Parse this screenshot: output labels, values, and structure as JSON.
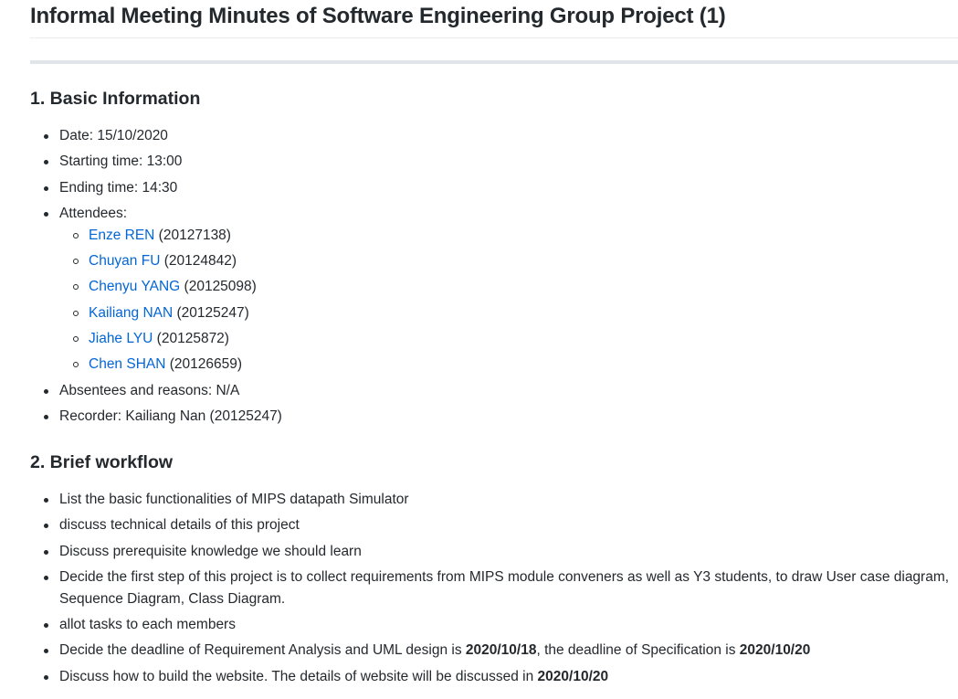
{
  "title": "Informal Meeting Minutes of Software Engineering Group Project (1)",
  "section1": {
    "heading": "1. Basic Information",
    "date": "Date: 15/10/2020",
    "start": "Starting time: 13:00",
    "end": "Ending time: 14:30",
    "attendees_label": "Attendees:",
    "attendees": [
      {
        "name": "Enze REN",
        "id": " (20127138)"
      },
      {
        "name": "Chuyan FU",
        "id": " (20124842)"
      },
      {
        "name": "Chenyu YANG",
        "id": " (20125098)"
      },
      {
        "name": "Kailiang NAN",
        "id": " (20125247)"
      },
      {
        "name": "Jiahe LYU",
        "id": " (20125872)"
      },
      {
        "name": "Chen SHAN",
        "id": " (20126659)"
      }
    ],
    "absentees": "Absentees and reasons: N/A",
    "recorder": "Recorder: Kailiang Nan (20125247)"
  },
  "section2": {
    "heading": "2. Brief workflow",
    "items": [
      "List the basic functionalities of MIPS datapath Simulator",
      "discuss technical details of this project",
      "Discuss prerequisite knowledge we should learn",
      "Decide the first step of this project is to collect requirements from MIPS module conveners as well as Y3 students, to draw User case diagram, Sequence Diagram, Class Diagram.",
      "allot tasks to each members"
    ],
    "deadline": {
      "a": "Decide the deadline of Requirement Analysis and UML design is ",
      "d1": "2020/10/18",
      "b": ", the deadline of Specification is ",
      "d2": "2020/10/20"
    },
    "website": {
      "a": "Discuss how to build the website. The details of website will be discussed in ",
      "d": "2020/10/20"
    }
  }
}
